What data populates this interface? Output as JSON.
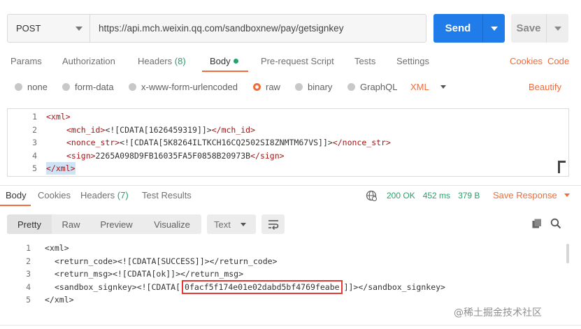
{
  "request": {
    "method": "POST",
    "url": "https://api.mch.weixin.qq.com/sandboxnew/pay/getsignkey",
    "send_label": "Send",
    "save_label": "Save"
  },
  "request_tabs": [
    {
      "label": "Params"
    },
    {
      "label": "Authorization"
    },
    {
      "label": "Headers",
      "count": "(8)"
    },
    {
      "label": "Body"
    },
    {
      "label": "Pre-request Script"
    },
    {
      "label": "Tests"
    },
    {
      "label": "Settings"
    }
  ],
  "request_links": {
    "cookies": "Cookies",
    "code": "Code"
  },
  "body_types": [
    {
      "label": "none"
    },
    {
      "label": "form-data"
    },
    {
      "label": "x-www-form-urlencoded"
    },
    {
      "label": "raw"
    },
    {
      "label": "binary"
    },
    {
      "label": "GraphQL"
    }
  ],
  "raw_language": "XML",
  "beautify_label": "Beautify",
  "request_body": {
    "line_numbers": [
      "1",
      "2",
      "3",
      "4",
      "5"
    ],
    "l1_open": "<xml>",
    "l2_open": "<mch_id>",
    "l2_val": "<![CDATA[1626459319]]>",
    "l2_close": "</mch_id>",
    "l3_open": "<nonce_str>",
    "l3_val": "<![CDATA[5K8264ILTKCH16CQ2502SI8ZNMTM67VS]]>",
    "l3_close": "</nonce_str>",
    "l4_open": "<sign>",
    "l4_val": "2265A098D9FB16035FA5F0858B20973B",
    "l4_close": "</sign>",
    "l5_close": "</xml>"
  },
  "response_tabs": [
    {
      "label": "Body"
    },
    {
      "label": "Cookies"
    },
    {
      "label": "Headers",
      "count": "(7)"
    },
    {
      "label": "Test Results"
    }
  ],
  "response_status": {
    "status": "200 OK",
    "time": "452 ms",
    "size": "379 B",
    "save_response": "Save Response"
  },
  "response_view": {
    "modes": [
      "Pretty",
      "Raw",
      "Preview",
      "Visualize"
    ],
    "format": "Text"
  },
  "response_body": {
    "line_numbers": [
      "1",
      "2",
      "3",
      "4",
      "5"
    ],
    "l1": "<xml>",
    "l2": "<return_code><![CDATA[SUCCESS]]></return_code>",
    "l3": "<return_msg><![CDATA[ok]]></return_msg>",
    "l4_pre": "<sandbox_signkey><![CDATA[",
    "l4_key": "0facf5f174e01e02dabd5bf4769feabe",
    "l4_post": "]]></sandbox_signkey>",
    "l5": "</xml>"
  },
  "watermark": "@稀土掘金技术社区",
  "colors": {
    "accent": "#f26b3a",
    "send_blue": "#1f7ce8",
    "success_green": "#26a16a",
    "highlight_red": "#e53935"
  }
}
